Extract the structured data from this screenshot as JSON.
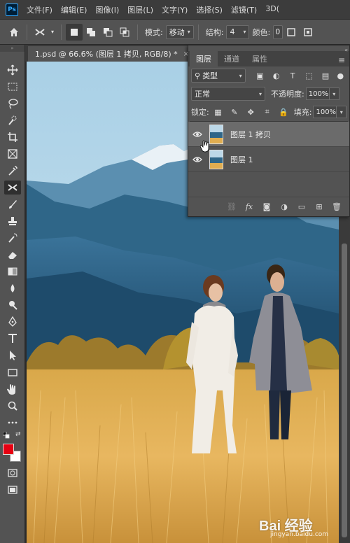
{
  "menubar": {
    "logo_text": "Ps",
    "items": [
      "文件(F)",
      "编辑(E)",
      "图像(I)",
      "图层(L)",
      "文字(Y)",
      "选择(S)",
      "滤镜(T)",
      "3D("
    ]
  },
  "options_bar": {
    "mode_label": "模式:",
    "mode_value": "移动",
    "structure_label": "结构:",
    "structure_value": "4",
    "color_label": "颜色:",
    "color_value": "0"
  },
  "document": {
    "tab_title": "1.psd @ 66.6% (图层 1 拷贝, RGB/8) *",
    "close_glyph": "×"
  },
  "layers_panel": {
    "tabs": [
      {
        "label": "图层",
        "active": true
      },
      {
        "label": "通道",
        "active": false
      },
      {
        "label": "属性",
        "active": false
      }
    ],
    "filter_kind": "类型",
    "blend_mode": "正常",
    "opacity_label": "不透明度:",
    "opacity_value": "100%",
    "lock_label": "锁定:",
    "fill_label": "填充:",
    "fill_value": "100%",
    "layers": [
      {
        "name": "图层 1 拷贝",
        "visible": true,
        "selected": true
      },
      {
        "name": "图层 1",
        "visible": true,
        "selected": false
      }
    ],
    "bottom_icons": [
      "link-icon",
      "fx-icon",
      "mask-icon",
      "adjustment-icon",
      "folder-icon",
      "new-layer-icon",
      "trash-icon"
    ]
  },
  "colors": {
    "foreground": "#e60012",
    "background": "#ffffff",
    "accent": "#31a8ff"
  },
  "watermark": {
    "text": "Bai 经验",
    "sub": "jingyan.baidu.com"
  }
}
